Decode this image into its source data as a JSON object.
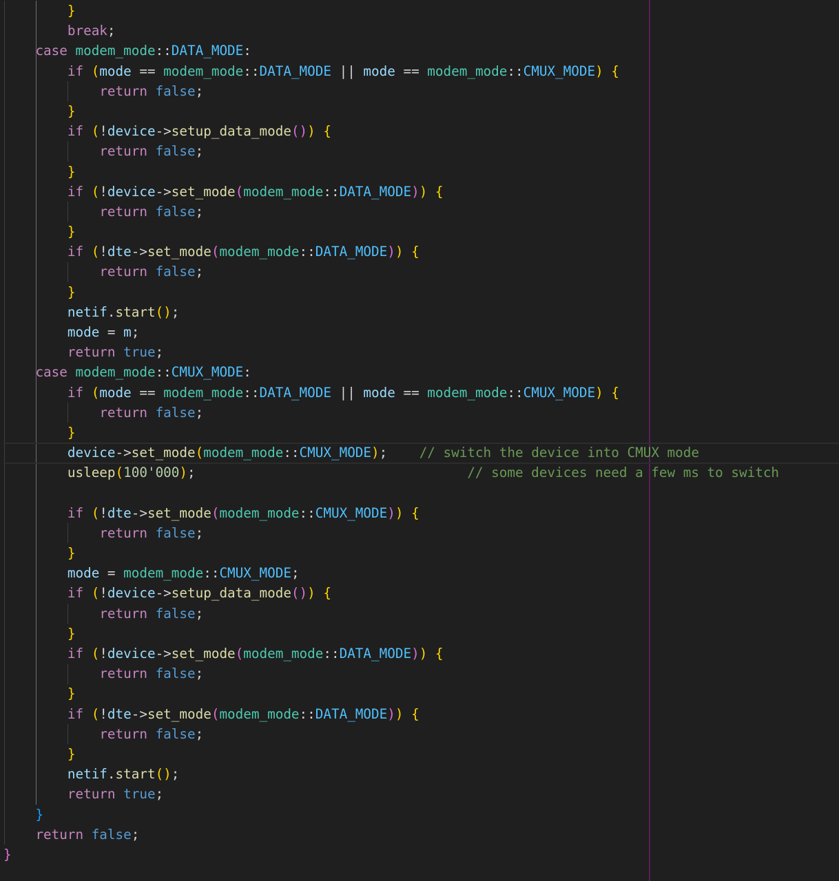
{
  "editor": {
    "colors": {
      "background": "#1f1f1f",
      "keyword": "#c586c0",
      "bool": "#569cd6",
      "type": "#4ec9b0",
      "enum": "#4fc1ff",
      "variable": "#9cdcfe",
      "function": "#dcdcaa",
      "number": "#b5cea8",
      "comment": "#6a9955",
      "brace_level_1": "#ffd700",
      "brace_level_2": "#da70d6",
      "brace_level_3": "#179fff",
      "ruler": "#5a1d5c"
    },
    "current_line": 22,
    "lines": [
      [
        {
          "t": "        "
        },
        {
          "t": "}",
          "c": "brace1"
        }
      ],
      [
        {
          "t": "        "
        },
        {
          "t": "break",
          "c": "keyword"
        },
        {
          "t": ";"
        }
      ],
      [
        {
          "t": "    "
        },
        {
          "t": "case",
          "c": "keyword"
        },
        {
          "t": " "
        },
        {
          "t": "modem_mode",
          "c": "type"
        },
        {
          "t": "::"
        },
        {
          "t": "DATA_MODE",
          "c": "enum"
        },
        {
          "t": ":"
        }
      ],
      [
        {
          "t": "        "
        },
        {
          "t": "if",
          "c": "keyword"
        },
        {
          "t": " "
        },
        {
          "t": "(",
          "c": "brace1"
        },
        {
          "t": "mode",
          "c": "var"
        },
        {
          "t": " == "
        },
        {
          "t": "modem_mode",
          "c": "type"
        },
        {
          "t": "::"
        },
        {
          "t": "DATA_MODE",
          "c": "enum"
        },
        {
          "t": " || "
        },
        {
          "t": "mode",
          "c": "var"
        },
        {
          "t": " == "
        },
        {
          "t": "modem_mode",
          "c": "type"
        },
        {
          "t": "::"
        },
        {
          "t": "CMUX_MODE",
          "c": "enum"
        },
        {
          "t": ")",
          "c": "brace1"
        },
        {
          "t": " "
        },
        {
          "t": "{",
          "c": "brace1"
        }
      ],
      [
        {
          "t": "            "
        },
        {
          "t": "return",
          "c": "keyword"
        },
        {
          "t": " "
        },
        {
          "t": "false",
          "c": "bool"
        },
        {
          "t": ";"
        }
      ],
      [
        {
          "t": "        "
        },
        {
          "t": "}",
          "c": "brace1"
        }
      ],
      [
        {
          "t": "        "
        },
        {
          "t": "if",
          "c": "keyword"
        },
        {
          "t": " "
        },
        {
          "t": "(",
          "c": "brace1"
        },
        {
          "t": "!"
        },
        {
          "t": "device",
          "c": "var"
        },
        {
          "t": "->"
        },
        {
          "t": "setup_data_mode",
          "c": "func"
        },
        {
          "t": "()",
          "c": "brace2"
        },
        {
          "t": ")",
          "c": "brace1"
        },
        {
          "t": " "
        },
        {
          "t": "{",
          "c": "brace1"
        }
      ],
      [
        {
          "t": "            "
        },
        {
          "t": "return",
          "c": "keyword"
        },
        {
          "t": " "
        },
        {
          "t": "false",
          "c": "bool"
        },
        {
          "t": ";"
        }
      ],
      [
        {
          "t": "        "
        },
        {
          "t": "}",
          "c": "brace1"
        }
      ],
      [
        {
          "t": "        "
        },
        {
          "t": "if",
          "c": "keyword"
        },
        {
          "t": " "
        },
        {
          "t": "(",
          "c": "brace1"
        },
        {
          "t": "!"
        },
        {
          "t": "device",
          "c": "var"
        },
        {
          "t": "->"
        },
        {
          "t": "set_mode",
          "c": "func"
        },
        {
          "t": "(",
          "c": "brace2"
        },
        {
          "t": "modem_mode",
          "c": "type"
        },
        {
          "t": "::"
        },
        {
          "t": "DATA_MODE",
          "c": "enum"
        },
        {
          "t": ")",
          "c": "brace2"
        },
        {
          "t": ")",
          "c": "brace1"
        },
        {
          "t": " "
        },
        {
          "t": "{",
          "c": "brace1"
        }
      ],
      [
        {
          "t": "            "
        },
        {
          "t": "return",
          "c": "keyword"
        },
        {
          "t": " "
        },
        {
          "t": "false",
          "c": "bool"
        },
        {
          "t": ";"
        }
      ],
      [
        {
          "t": "        "
        },
        {
          "t": "}",
          "c": "brace1"
        }
      ],
      [
        {
          "t": "        "
        },
        {
          "t": "if",
          "c": "keyword"
        },
        {
          "t": " "
        },
        {
          "t": "(",
          "c": "brace1"
        },
        {
          "t": "!"
        },
        {
          "t": "dte",
          "c": "var"
        },
        {
          "t": "->"
        },
        {
          "t": "set_mode",
          "c": "func"
        },
        {
          "t": "(",
          "c": "brace2"
        },
        {
          "t": "modem_mode",
          "c": "type"
        },
        {
          "t": "::"
        },
        {
          "t": "DATA_MODE",
          "c": "enum"
        },
        {
          "t": ")",
          "c": "brace2"
        },
        {
          "t": ")",
          "c": "brace1"
        },
        {
          "t": " "
        },
        {
          "t": "{",
          "c": "brace1"
        }
      ],
      [
        {
          "t": "            "
        },
        {
          "t": "return",
          "c": "keyword"
        },
        {
          "t": " "
        },
        {
          "t": "false",
          "c": "bool"
        },
        {
          "t": ";"
        }
      ],
      [
        {
          "t": "        "
        },
        {
          "t": "}",
          "c": "brace1"
        }
      ],
      [
        {
          "t": "        "
        },
        {
          "t": "netif",
          "c": "var"
        },
        {
          "t": "."
        },
        {
          "t": "start",
          "c": "func"
        },
        {
          "t": "()",
          "c": "brace1"
        },
        {
          "t": ";"
        }
      ],
      [
        {
          "t": "        "
        },
        {
          "t": "mode",
          "c": "var"
        },
        {
          "t": " = "
        },
        {
          "t": "m",
          "c": "var"
        },
        {
          "t": ";"
        }
      ],
      [
        {
          "t": "        "
        },
        {
          "t": "return",
          "c": "keyword"
        },
        {
          "t": " "
        },
        {
          "t": "true",
          "c": "bool"
        },
        {
          "t": ";"
        }
      ],
      [
        {
          "t": "    "
        },
        {
          "t": "case",
          "c": "keyword"
        },
        {
          "t": " "
        },
        {
          "t": "modem_mode",
          "c": "type"
        },
        {
          "t": "::"
        },
        {
          "t": "CMUX_MODE",
          "c": "enum"
        },
        {
          "t": ":"
        }
      ],
      [
        {
          "t": "        "
        },
        {
          "t": "if",
          "c": "keyword"
        },
        {
          "t": " "
        },
        {
          "t": "(",
          "c": "brace1"
        },
        {
          "t": "mode",
          "c": "var"
        },
        {
          "t": " == "
        },
        {
          "t": "modem_mode",
          "c": "type"
        },
        {
          "t": "::"
        },
        {
          "t": "DATA_MODE",
          "c": "enum"
        },
        {
          "t": " || "
        },
        {
          "t": "mode",
          "c": "var"
        },
        {
          "t": " == "
        },
        {
          "t": "modem_mode",
          "c": "type"
        },
        {
          "t": "::"
        },
        {
          "t": "CMUX_MODE",
          "c": "enum"
        },
        {
          "t": ")",
          "c": "brace1"
        },
        {
          "t": " "
        },
        {
          "t": "{",
          "c": "brace1"
        }
      ],
      [
        {
          "t": "            "
        },
        {
          "t": "return",
          "c": "keyword"
        },
        {
          "t": " "
        },
        {
          "t": "false",
          "c": "bool"
        },
        {
          "t": ";"
        }
      ],
      [
        {
          "t": "        "
        },
        {
          "t": "}",
          "c": "brace1"
        }
      ],
      [
        {
          "t": "        "
        },
        {
          "t": "device",
          "c": "var"
        },
        {
          "t": "->"
        },
        {
          "t": "set_mode",
          "c": "func"
        },
        {
          "t": "(",
          "c": "brace1"
        },
        {
          "t": "modem_mode",
          "c": "type"
        },
        {
          "t": "::"
        },
        {
          "t": "CMUX_MODE",
          "c": "enum"
        },
        {
          "t": ")",
          "c": "brace1"
        },
        {
          "t": ";    "
        },
        {
          "t": "// switch the device into CMUX mode",
          "c": "comment"
        }
      ],
      [
        {
          "t": "        "
        },
        {
          "t": "usleep",
          "c": "func"
        },
        {
          "t": "(",
          "c": "brace1"
        },
        {
          "t": "100'000",
          "c": "number"
        },
        {
          "t": ")",
          "c": "brace1"
        },
        {
          "t": ";                                  "
        },
        {
          "t": "// some devices need a few ms to switch",
          "c": "comment"
        }
      ],
      [],
      [
        {
          "t": "        "
        },
        {
          "t": "if",
          "c": "keyword"
        },
        {
          "t": " "
        },
        {
          "t": "(",
          "c": "brace1"
        },
        {
          "t": "!"
        },
        {
          "t": "dte",
          "c": "var"
        },
        {
          "t": "->"
        },
        {
          "t": "set_mode",
          "c": "func"
        },
        {
          "t": "(",
          "c": "brace2"
        },
        {
          "t": "modem_mode",
          "c": "type"
        },
        {
          "t": "::"
        },
        {
          "t": "CMUX_MODE",
          "c": "enum"
        },
        {
          "t": ")",
          "c": "brace2"
        },
        {
          "t": ")",
          "c": "brace1"
        },
        {
          "t": " "
        },
        {
          "t": "{",
          "c": "brace1"
        }
      ],
      [
        {
          "t": "            "
        },
        {
          "t": "return",
          "c": "keyword"
        },
        {
          "t": " "
        },
        {
          "t": "false",
          "c": "bool"
        },
        {
          "t": ";"
        }
      ],
      [
        {
          "t": "        "
        },
        {
          "t": "}",
          "c": "brace1"
        }
      ],
      [
        {
          "t": "        "
        },
        {
          "t": "mode",
          "c": "var"
        },
        {
          "t": " = "
        },
        {
          "t": "modem_mode",
          "c": "type"
        },
        {
          "t": "::"
        },
        {
          "t": "CMUX_MODE",
          "c": "enum"
        },
        {
          "t": ";"
        }
      ],
      [
        {
          "t": "        "
        },
        {
          "t": "if",
          "c": "keyword"
        },
        {
          "t": " "
        },
        {
          "t": "(",
          "c": "brace1"
        },
        {
          "t": "!"
        },
        {
          "t": "device",
          "c": "var"
        },
        {
          "t": "->"
        },
        {
          "t": "setup_data_mode",
          "c": "func"
        },
        {
          "t": "()",
          "c": "brace2"
        },
        {
          "t": ")",
          "c": "brace1"
        },
        {
          "t": " "
        },
        {
          "t": "{",
          "c": "brace1"
        }
      ],
      [
        {
          "t": "            "
        },
        {
          "t": "return",
          "c": "keyword"
        },
        {
          "t": " "
        },
        {
          "t": "false",
          "c": "bool"
        },
        {
          "t": ";"
        }
      ],
      [
        {
          "t": "        "
        },
        {
          "t": "}",
          "c": "brace1"
        }
      ],
      [
        {
          "t": "        "
        },
        {
          "t": "if",
          "c": "keyword"
        },
        {
          "t": " "
        },
        {
          "t": "(",
          "c": "brace1"
        },
        {
          "t": "!"
        },
        {
          "t": "device",
          "c": "var"
        },
        {
          "t": "->"
        },
        {
          "t": "set_mode",
          "c": "func"
        },
        {
          "t": "(",
          "c": "brace2"
        },
        {
          "t": "modem_mode",
          "c": "type"
        },
        {
          "t": "::"
        },
        {
          "t": "DATA_MODE",
          "c": "enum"
        },
        {
          "t": ")",
          "c": "brace2"
        },
        {
          "t": ")",
          "c": "brace1"
        },
        {
          "t": " "
        },
        {
          "t": "{",
          "c": "brace1"
        }
      ],
      [
        {
          "t": "            "
        },
        {
          "t": "return",
          "c": "keyword"
        },
        {
          "t": " "
        },
        {
          "t": "false",
          "c": "bool"
        },
        {
          "t": ";"
        }
      ],
      [
        {
          "t": "        "
        },
        {
          "t": "}",
          "c": "brace1"
        }
      ],
      [
        {
          "t": "        "
        },
        {
          "t": "if",
          "c": "keyword"
        },
        {
          "t": " "
        },
        {
          "t": "(",
          "c": "brace1"
        },
        {
          "t": "!"
        },
        {
          "t": "dte",
          "c": "var"
        },
        {
          "t": "->"
        },
        {
          "t": "set_mode",
          "c": "func"
        },
        {
          "t": "(",
          "c": "brace2"
        },
        {
          "t": "modem_mode",
          "c": "type"
        },
        {
          "t": "::"
        },
        {
          "t": "DATA_MODE",
          "c": "enum"
        },
        {
          "t": ")",
          "c": "brace2"
        },
        {
          "t": ")",
          "c": "brace1"
        },
        {
          "t": " "
        },
        {
          "t": "{",
          "c": "brace1"
        }
      ],
      [
        {
          "t": "            "
        },
        {
          "t": "return",
          "c": "keyword"
        },
        {
          "t": " "
        },
        {
          "t": "false",
          "c": "bool"
        },
        {
          "t": ";"
        }
      ],
      [
        {
          "t": "        "
        },
        {
          "t": "}",
          "c": "brace1"
        }
      ],
      [
        {
          "t": "        "
        },
        {
          "t": "netif",
          "c": "var"
        },
        {
          "t": "."
        },
        {
          "t": "start",
          "c": "func"
        },
        {
          "t": "()",
          "c": "brace1"
        },
        {
          "t": ";"
        }
      ],
      [
        {
          "t": "        "
        },
        {
          "t": "return",
          "c": "keyword"
        },
        {
          "t": " "
        },
        {
          "t": "true",
          "c": "bool"
        },
        {
          "t": ";"
        }
      ],
      [
        {
          "t": "    "
        },
        {
          "t": "}",
          "c": "brace3"
        }
      ],
      [
        {
          "t": "    "
        },
        {
          "t": "return",
          "c": "keyword"
        },
        {
          "t": " "
        },
        {
          "t": "false",
          "c": "bool"
        },
        {
          "t": ";"
        }
      ],
      [
        {
          "t": "}",
          "c": "brace2"
        }
      ]
    ]
  }
}
